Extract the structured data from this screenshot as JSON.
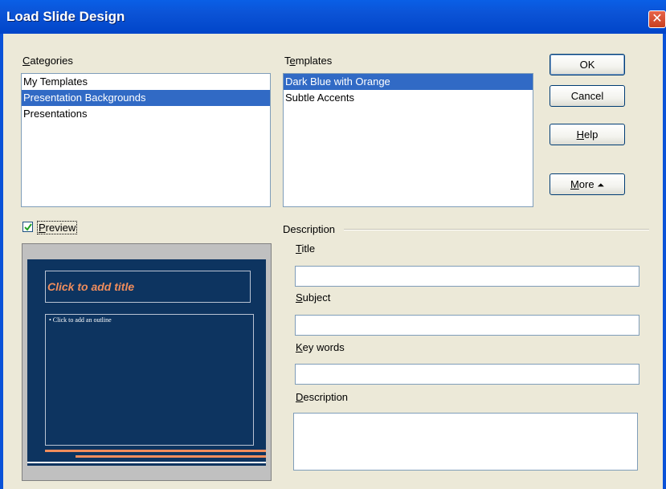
{
  "window": {
    "title": "Load Slide Design",
    "close_glyph": "✕"
  },
  "categories": {
    "label_pre": "",
    "label_ul": "C",
    "label_post": "ategories",
    "items": [
      "My Templates",
      "Presentation Backgrounds",
      "Presentations"
    ],
    "selected_index": 1
  },
  "templates": {
    "label_pre": "T",
    "label_ul": "e",
    "label_post": "mplates",
    "items": [
      "Dark Blue with Orange",
      "Subtle Accents"
    ],
    "selected_index": 0
  },
  "buttons": {
    "ok": "OK",
    "cancel": "Cancel",
    "help_ul": "H",
    "help_post": "elp",
    "more_ul": "M",
    "more_post": "ore",
    "more_arrow": "⏶"
  },
  "preview": {
    "checkbox_checked": true,
    "label_ul": "P",
    "label_post": "review",
    "slide": {
      "title": "Click to add title",
      "outline": "•  Click to add an outline",
      "background": "#0d3460",
      "accent": "#f08d5c"
    }
  },
  "description": {
    "group_label": "Description",
    "title_label_ul": "T",
    "title_label_post": "itle",
    "subject_label_ul": "S",
    "subject_label_post": "ubject",
    "keywords_label_ul": "K",
    "keywords_label_post": "ey words",
    "description_label_ul": "D",
    "description_label_post": "escription",
    "title_value": "",
    "subject_value": "",
    "keywords_value": "",
    "description_value": ""
  },
  "colors": {
    "titlebar": "#0b53d6",
    "selection": "#316ac5",
    "dialog_bg": "#ece9d8"
  }
}
